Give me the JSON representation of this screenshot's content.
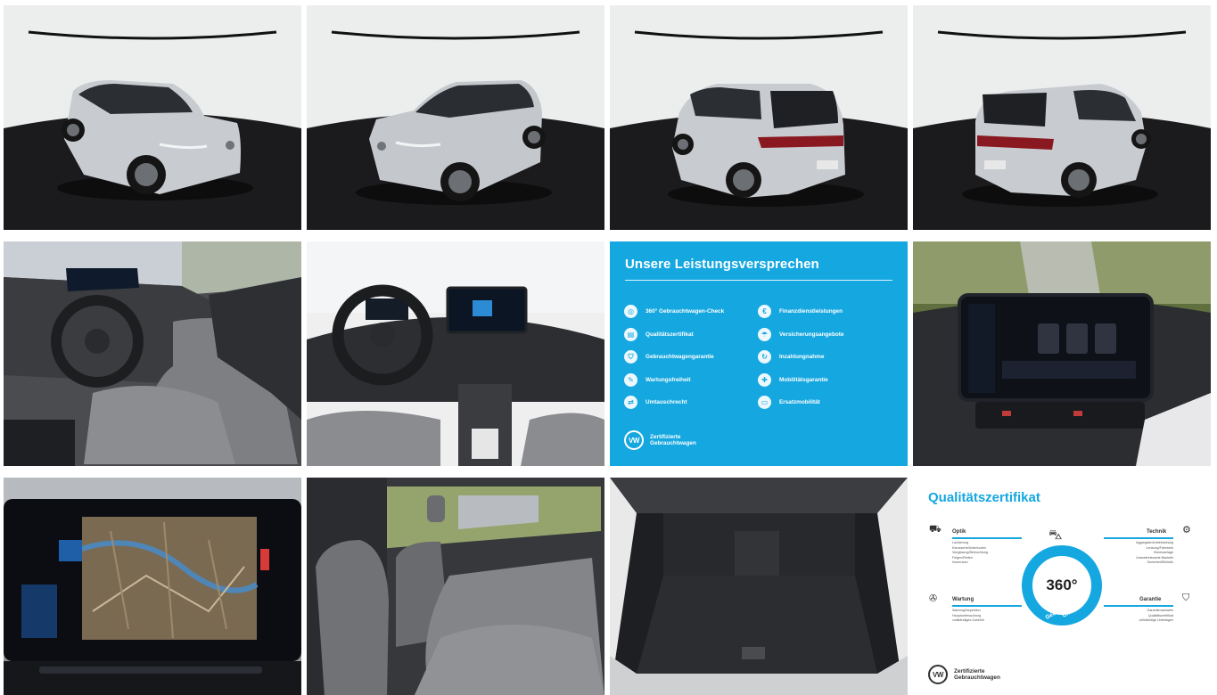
{
  "gallery": {
    "photos": [
      {
        "name": "exterior-front-left"
      },
      {
        "name": "exterior-front-right"
      },
      {
        "name": "exterior-rear-left"
      },
      {
        "name": "exterior-rear-right"
      },
      {
        "name": "interior-driver-side"
      },
      {
        "name": "interior-dashboard"
      },
      {
        "name": "infotainment-screen"
      },
      {
        "name": "navigation-screen"
      },
      {
        "name": "rear-seats"
      },
      {
        "name": "trunk"
      }
    ]
  },
  "promo_services": {
    "title": "Unsere Leistungsversprechen",
    "left_items": [
      "360° Gebrauchtwagen-Check",
      "Qualitätszertifikat",
      "Gebrauchtwagengarantie",
      "Wartungsfreiheit",
      "Umtauschrecht"
    ],
    "right_items": [
      "Finanzdienstleistungen",
      "Versicherungsangebote",
      "Inzahlungnahme",
      "Mobilitätsgarantie",
      "Ersatzmobilität"
    ],
    "footer": {
      "line1": "Zertifizierte",
      "line2": "Gebrauchtwagen"
    }
  },
  "promo_certificate": {
    "title": "Qualitätszertifikat",
    "center_value": "360°",
    "center_caption": "Gebrauchtwagen-Check",
    "optik": {
      "label": "Optik",
      "items": [
        "Lackierung",
        "Karosserie/Unterboden",
        "Verglasung/Beleuchtung",
        "Felgen/Reifen",
        "Innenraum"
      ]
    },
    "technik": {
      "label": "Technik",
      "items": [
        "Aggregate/Antriebsstrang",
        "Lenkung/Fahrwerk",
        "Bremsanlage",
        "Umweltrelevante Bauteile",
        "Sicherheit/Elektrik"
      ]
    },
    "wartung": {
      "label": "Wartung",
      "items": [
        "Wartung/Inspektion",
        "Hauptuntersuchung",
        "vollständiges Zubehör"
      ]
    },
    "garantie": {
      "label": "Garantie",
      "items": [
        "Garantienachweis",
        "Qualitätszertifikat",
        "vollständige Unterlagen"
      ]
    },
    "footer": {
      "line1": "Zertifizierte",
      "line2": "Gebrauchtwagen"
    }
  },
  "colors": {
    "vw_blue": "#15a7e0",
    "car_silver": "#c9ccd1",
    "studio_floor": "#1b1b1d",
    "interior_grey": "#7d7f83"
  },
  "icons": {
    "logo": "vw-logo-icon"
  }
}
